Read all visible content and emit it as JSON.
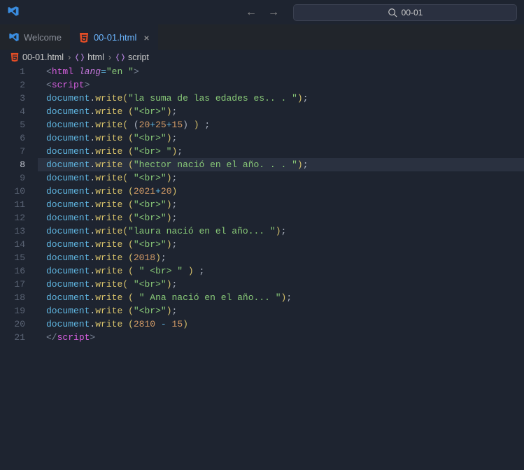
{
  "search": {
    "placeholder": "00-01"
  },
  "tabs": {
    "welcome": "Welcome",
    "file": "00-01.html"
  },
  "breadcrumbs": {
    "file": "00-01.html",
    "tag1": "html",
    "tag2": "script"
  },
  "code": {
    "html": "html",
    "lang_attr": "lang",
    "eq": "=",
    "lang_val": "\"en \"",
    "script": "script",
    "doc": "document",
    "write": "write",
    "s_suma": "\"la suma de las edades es.. . \"",
    "s_br": "\"<br>\"",
    "s_br_sp": "\"<br> \"",
    "s_br_sp2": "\" <br> \"",
    "s_hector": "\"hector nació en el año. . . \"",
    "s_laura": "\"laura nació en el año... \"",
    "s_ana": "\" Ana nació en el año... \"",
    "n20": "20",
    "n25": "25",
    "n15": "15",
    "n2021": "2021",
    "n2018": "2018",
    "n2810": "2810",
    "lines": [
      "1",
      "2",
      "3",
      "4",
      "5",
      "6",
      "7",
      "8",
      "9",
      "10",
      "11",
      "12",
      "13",
      "14",
      "15",
      "16",
      "17",
      "18",
      "19",
      "20",
      "21"
    ],
    "current_line": "8"
  }
}
